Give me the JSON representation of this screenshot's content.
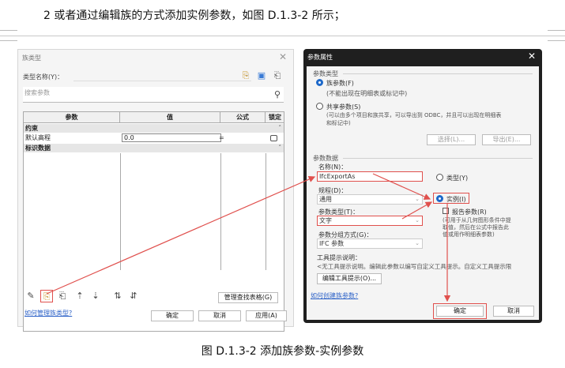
{
  "doc": {
    "instruction": "2 或者通过编辑族的方式添加实例参数，如图 D.1.3-2 所示；",
    "figure_caption": "图 D.1.3-2 添加族参数-实例参数"
  },
  "family_types_dialog": {
    "title": "族类型",
    "close": "✕",
    "type_name_label": "类型名称(Y)：",
    "search_placeholder": "搜索参数",
    "columns": [
      "参数",
      "值",
      "公式",
      "锁定"
    ],
    "groups": [
      {
        "name": "约束",
        "rows": [
          {
            "name": "默认高程",
            "value": "0.0",
            "formula": "="
          }
        ]
      },
      {
        "name": "标识数据",
        "rows": []
      }
    ],
    "manage_lookup_button": "管理查找表格(G)",
    "help_link": "如何管理族类型?",
    "ok_button": "确定",
    "cancel_button": "取消",
    "apply_button": "应用(A)"
  },
  "parameter_properties_dialog": {
    "title": "参数属性",
    "close": "✕",
    "param_type_label": "参数类型",
    "family_param_label": "族参数(F)",
    "family_param_note": "(不能出现在明细表或标记中)",
    "shared_param_label": "共享参数(S)",
    "shared_param_note_1": "(可以由多个项目和族共享，可以导出到 ODBC，并且可以出现在明细表",
    "shared_param_note_2": "和标记中)",
    "select_button": "选择(L)...",
    "export_button": "导出(E)...",
    "param_data_label": "参数数据",
    "name_label": "名称(N)：",
    "name_value": "IfcExportAs",
    "type_radio_label": "类型(Y)",
    "discipline_label": "规程(D)：",
    "discipline_value": "通用",
    "instance_radio_label": "实例(I)",
    "param_kind_label": "参数类型(T)：",
    "param_kind_value": "文字",
    "report_param_label": "报告参数(R)",
    "report_note_1": "(可用于从几何图形条件中提",
    "report_note_2": "取值，然后在公式中报告此",
    "report_note_3": "值或用作明细表参数)",
    "group_label": "参数分组方式(G)：",
    "group_value": "IFC 参数",
    "tooltip_label": "工具提示说明：",
    "tooltip_value": "<无工具提示说明。编辑此参数以编写自定义工具提示。自定义工具提示限",
    "edit_tooltip_button": "编辑工具提示(O)...",
    "help_link": "如何创建族参数?",
    "ok_button": "确定",
    "cancel_button": "取消"
  },
  "colors": {
    "annotation_red": "#e0504d",
    "radio_blue": "#1d68c9",
    "link_blue": "#2e63c8",
    "title_bar": "#1f1f1f"
  },
  "icons": [
    "pencil-icon",
    "new-parameter-icon",
    "edit-parameter-icon",
    "move-up-icon",
    "move-down-icon",
    "sort-ascending-icon",
    "sort-descending-icon",
    "search-icon",
    "close-icon",
    "chevron-down-icon"
  ]
}
